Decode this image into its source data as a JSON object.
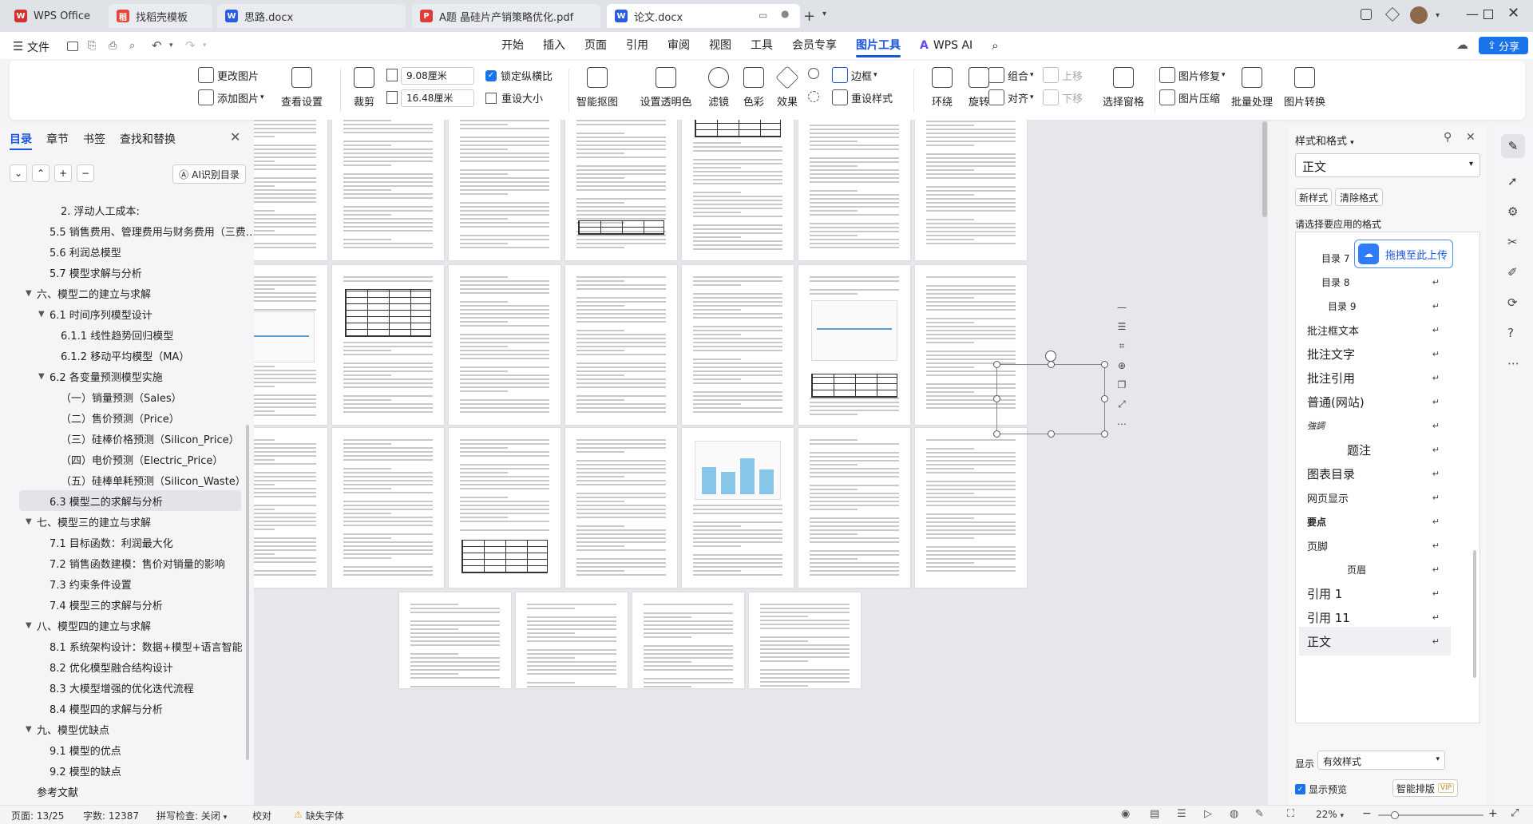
{
  "tabs": [
    {
      "label": "WPS Office",
      "color": "#d63031",
      "glyph": "W"
    },
    {
      "label": "找稻壳模板",
      "color": "#e8453c",
      "glyph": "稻"
    },
    {
      "label": "思路.docx",
      "color": "#2b5ce6",
      "glyph": "W"
    },
    {
      "label": "A题 晶硅片产销策略优化.pdf",
      "color": "#e03b3b",
      "glyph": "P"
    },
    {
      "label": "论文.docx",
      "color": "#2b5ce6",
      "glyph": "W"
    }
  ],
  "menu": {
    "file": "文件",
    "items": [
      "开始",
      "插入",
      "页面",
      "引用",
      "审阅",
      "视图",
      "工具",
      "会员专享",
      "图片工具"
    ],
    "wps_ai": "WPS AI",
    "share": "分享"
  },
  "ribbon": {
    "change_pic": "更改图片",
    "add_pic": "添加图片",
    "view_settings": "查看设置",
    "crop": "裁剪",
    "width": "9.08厘米",
    "height": "16.48厘米",
    "lock_ratio": "锁定纵横比",
    "reset_size": "重设大小",
    "smart_cutout": "智能抠图",
    "set_transparent": "设置透明色",
    "filter": "滤镜",
    "color": "色彩",
    "effect": "效果",
    "border": "边框",
    "reset_style": "重设样式",
    "wrap": "环绕",
    "rotate": "旋转",
    "group": "组合",
    "align": "对齐",
    "up": "上移",
    "down": "下移",
    "selection_pane": "选择窗格",
    "repair": "图片修复",
    "compress": "图片压缩",
    "batch": "批量处理",
    "convert": "图片转换"
  },
  "left": {
    "tabs": [
      "目录",
      "章节",
      "书签",
      "查找和替换"
    ],
    "ai_toc": "AI识别目录",
    "items": [
      {
        "text": "2. 浮动人工成本:",
        "indent": 3,
        "caret": ""
      },
      {
        "text": "5.5 销售费用、管理费用与财务费用（三费…",
        "indent": 2,
        "caret": ""
      },
      {
        "text": "5.6 利润总模型",
        "indent": 2,
        "caret": ""
      },
      {
        "text": "5.7 模型求解与分析",
        "indent": 2,
        "caret": ""
      },
      {
        "text": "六、模型二的建立与求解",
        "indent": 1,
        "caret": "▼"
      },
      {
        "text": "6.1 时间序列模型设计",
        "indent": 2,
        "caret": "▼"
      },
      {
        "text": "6.1.1 线性趋势回归模型",
        "indent": 3,
        "caret": ""
      },
      {
        "text": "6.1.2 移动平均模型（MA）",
        "indent": 3,
        "caret": ""
      },
      {
        "text": "6.2 各变量预测模型实施",
        "indent": 2,
        "caret": "▼"
      },
      {
        "text": "（一）销量预测（Sales）",
        "indent": 3,
        "caret": ""
      },
      {
        "text": "（二）售价预测（Price）",
        "indent": 3,
        "caret": ""
      },
      {
        "text": "（三）硅棒价格预测（Silicon_Price）",
        "indent": 3,
        "caret": ""
      },
      {
        "text": "（四）电价预测（Electric_Price）",
        "indent": 3,
        "caret": ""
      },
      {
        "text": "（五）硅棒单耗预测（Silicon_Waste）",
        "indent": 3,
        "caret": ""
      },
      {
        "text": "6.3 模型二的求解与分析",
        "indent": 2,
        "caret": "",
        "sel": true
      },
      {
        "text": "七、模型三的建立与求解",
        "indent": 1,
        "caret": "▼"
      },
      {
        "text": "7.1 目标函数：利润最大化",
        "indent": 2,
        "caret": ""
      },
      {
        "text": "7.2 销售函数建模：售价对销量的影响",
        "indent": 2,
        "caret": ""
      },
      {
        "text": "7.3 约束条件设置",
        "indent": 2,
        "caret": ""
      },
      {
        "text": "7.4 模型三的求解与分析",
        "indent": 2,
        "caret": ""
      },
      {
        "text": "八、模型四的建立与求解",
        "indent": 1,
        "caret": "▼"
      },
      {
        "text": "8.1 系统架构设计：数据+模型+语言智能",
        "indent": 2,
        "caret": ""
      },
      {
        "text": "8.2 优化模型融合结构设计",
        "indent": 2,
        "caret": ""
      },
      {
        "text": "8.3 大模型增强的优化迭代流程",
        "indent": 2,
        "caret": ""
      },
      {
        "text": "8.4 模型四的求解与分析",
        "indent": 2,
        "caret": ""
      },
      {
        "text": "九、模型优缺点",
        "indent": 1,
        "caret": "▼"
      },
      {
        "text": "9.1 模型的优点",
        "indent": 2,
        "caret": ""
      },
      {
        "text": "9.2 模型的缺点",
        "indent": 2,
        "caret": ""
      },
      {
        "text": "参考文献",
        "indent": 1,
        "caret": ""
      }
    ]
  },
  "right": {
    "title": "样式和格式",
    "current_style": "正文",
    "new_style": "新样式",
    "clear_format": "清除格式",
    "apply_label": "请选择要应用的格式",
    "upload": "拖拽至此上传",
    "styles": [
      "目录 7",
      "目录 8",
      "目录 9",
      "批注框文本",
      "批注文字",
      "批注引用",
      "普通(网站)",
      "強調",
      "题注",
      "图表目录",
      "网页显示",
      "要点",
      "页脚",
      "页眉",
      "引用 1",
      "引用 11",
      "正文"
    ],
    "show_label": "显示",
    "show_value": "有效样式",
    "preview": "显示预览",
    "smart_layout": "智能排版",
    "vip": "VIP"
  },
  "status": {
    "page": "页面: 13/25",
    "words": "字数: 12387",
    "spell": "拼写检查: 关闭",
    "proof": "校对",
    "missing_font": "缺失字体",
    "zoom": "22%"
  }
}
